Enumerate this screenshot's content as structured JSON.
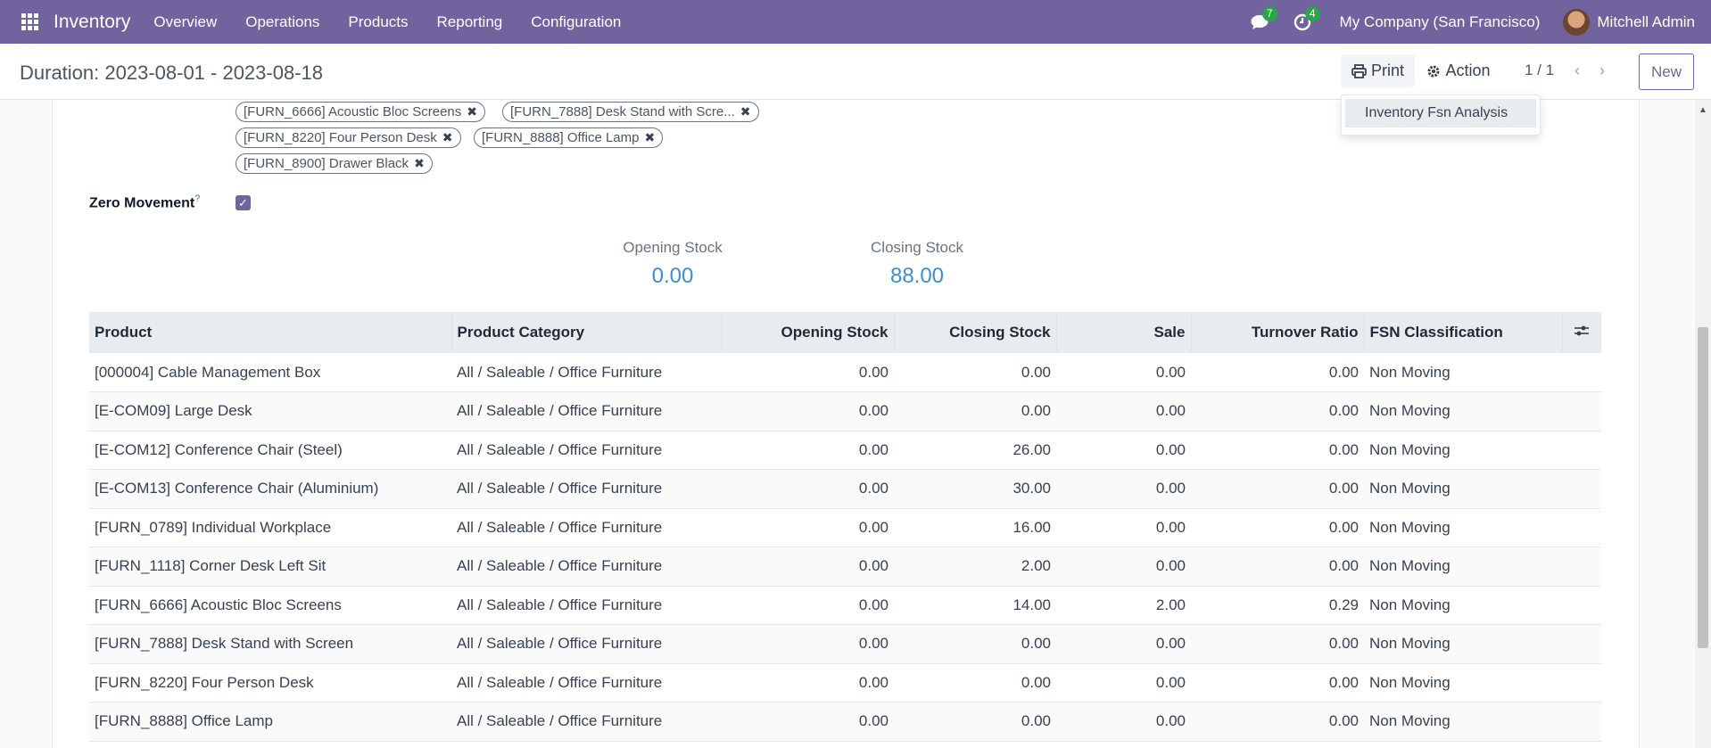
{
  "navbar": {
    "app_name": "Inventory",
    "menu": [
      "Overview",
      "Operations",
      "Products",
      "Reporting",
      "Configuration"
    ],
    "messages_count": "7",
    "activities_count": "4",
    "company": "My Company (San Francisco)",
    "user": "Mitchell Admin",
    "color": "#71639e"
  },
  "control_panel": {
    "title": "Duration: 2023-08-01 - 2023-08-18",
    "print_label": "Print",
    "action_label": "Action",
    "pager": "1 / 1",
    "new_label": "New"
  },
  "dropdown": {
    "items": [
      "Inventory Fsn Analysis"
    ]
  },
  "form": {
    "product_tags": [
      "[FURN_6666] Acoustic Bloc Screens",
      "[FURN_7888] Desk Stand with Scre...",
      "[FURN_8220] Four Person Desk",
      "[FURN_8888] Office Lamp",
      "[FURN_8900] Drawer Black"
    ],
    "zero_movement_label": "Zero Movement",
    "zero_movement_help": "?",
    "zero_movement_checked": true,
    "opening_stock_label": "Opening Stock",
    "opening_stock_value": "0.00",
    "closing_stock_label": "Closing Stock",
    "closing_stock_value": "88.00"
  },
  "table": {
    "headers": [
      "Product",
      "Product Category",
      "Opening Stock",
      "Closing Stock",
      "Sale",
      "Turnover Ratio",
      "FSN Classification"
    ],
    "rows": [
      [
        "[000004] Cable Management Box",
        "All / Saleable / Office Furniture",
        "0.00",
        "0.00",
        "0.00",
        "0.00",
        "Non Moving"
      ],
      [
        "[E-COM09] Large Desk",
        "All / Saleable / Office Furniture",
        "0.00",
        "0.00",
        "0.00",
        "0.00",
        "Non Moving"
      ],
      [
        "[E-COM12] Conference Chair (Steel)",
        "All / Saleable / Office Furniture",
        "0.00",
        "26.00",
        "0.00",
        "0.00",
        "Non Moving"
      ],
      [
        "[E-COM13] Conference Chair (Aluminium)",
        "All / Saleable / Office Furniture",
        "0.00",
        "30.00",
        "0.00",
        "0.00",
        "Non Moving"
      ],
      [
        "[FURN_0789] Individual Workplace",
        "All / Saleable / Office Furniture",
        "0.00",
        "16.00",
        "0.00",
        "0.00",
        "Non Moving"
      ],
      [
        "[FURN_1118] Corner Desk Left Sit",
        "All / Saleable / Office Furniture",
        "0.00",
        "2.00",
        "0.00",
        "0.00",
        "Non Moving"
      ],
      [
        "[FURN_6666] Acoustic Bloc Screens",
        "All / Saleable / Office Furniture",
        "0.00",
        "14.00",
        "2.00",
        "0.29",
        "Non Moving"
      ],
      [
        "[FURN_7888] Desk Stand with Screen",
        "All / Saleable / Office Furniture",
        "0.00",
        "0.00",
        "0.00",
        "0.00",
        "Non Moving"
      ],
      [
        "[FURN_8220] Four Person Desk",
        "All / Saleable / Office Furniture",
        "0.00",
        "0.00",
        "0.00",
        "0.00",
        "Non Moving"
      ],
      [
        "[FURN_8888] Office Lamp",
        "All / Saleable / Office Furniture",
        "0.00",
        "0.00",
        "0.00",
        "0.00",
        "Non Moving"
      ]
    ]
  }
}
